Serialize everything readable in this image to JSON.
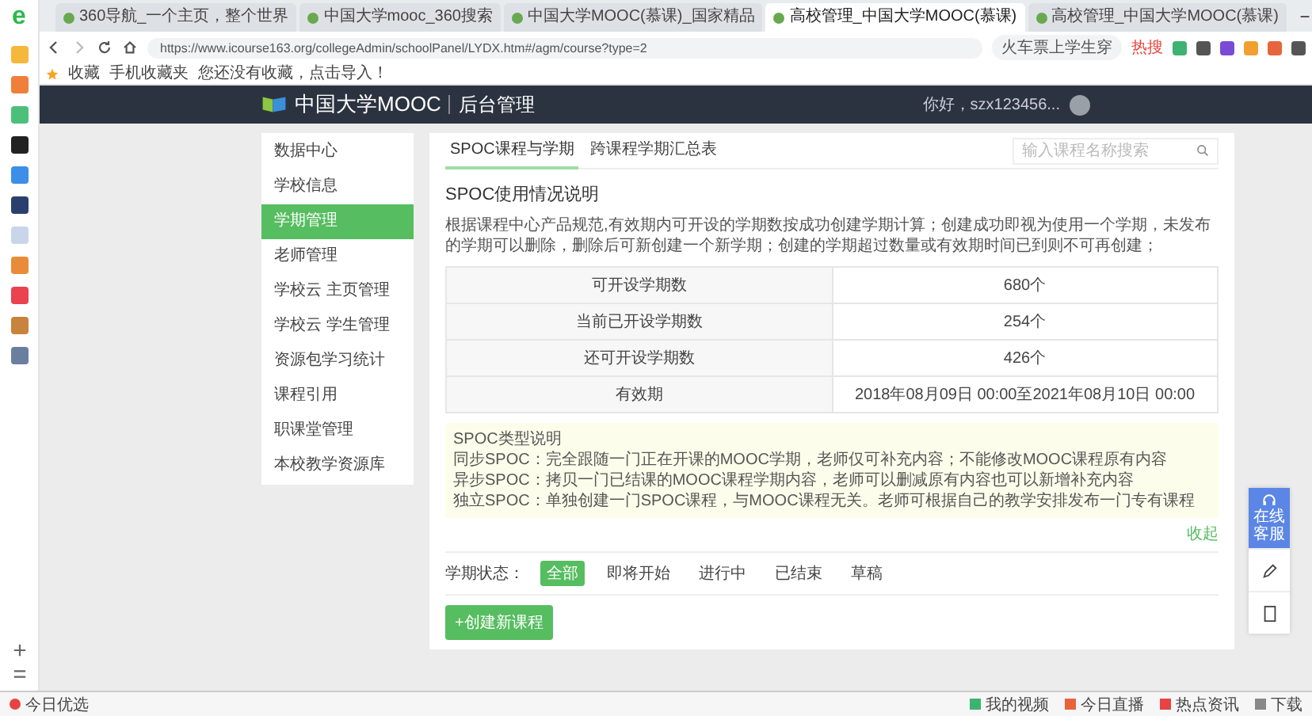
{
  "browser": {
    "logo": "e",
    "tabs": [
      {
        "title": "360导航_一个主页，整个世界",
        "selected": false
      },
      {
        "title": "中国大学mooc_360搜索",
        "selected": false
      },
      {
        "title": "中国大学MOOC(慕课)_国家精品",
        "selected": false
      },
      {
        "title": "高校管理_中国大学MOOC(慕课)",
        "selected": true
      },
      {
        "title": "高校管理_中国大学MOOC(慕课)",
        "selected": false
      }
    ],
    "url": "https://www.icourse163.org/collegeAdmin/schoolPanel/LYDX.htm#/agm/course?type=2",
    "search": {
      "value": "火车票上学生穿",
      "hot": "热搜"
    },
    "bookmarks": {
      "label": "收藏",
      "mobile": "手机收藏夹",
      "hint": "您还没有收藏，点击导入！"
    }
  },
  "header": {
    "logo": "中国大学MOOC",
    "subtitle": "后台管理",
    "greeting": "你好，szx123456..."
  },
  "sidebar": {
    "items": [
      {
        "label": "数据中心",
        "selected": false
      },
      {
        "label": "学校信息",
        "selected": false
      },
      {
        "label": "学期管理",
        "selected": true
      },
      {
        "label": "老师管理",
        "selected": false
      },
      {
        "label": "学校云 主页管理",
        "selected": false
      },
      {
        "label": "学校云 学生管理",
        "selected": false
      },
      {
        "label": "资源包学习统计",
        "selected": false
      },
      {
        "label": "课程引用",
        "selected": false
      },
      {
        "label": "职课堂管理",
        "selected": false
      },
      {
        "label": "本校教学资源库",
        "selected": false
      }
    ]
  },
  "panel": {
    "tabs": [
      {
        "label": "SPOC课程与学期",
        "selected": true
      },
      {
        "label": "跨课程学期汇总表",
        "selected": false
      }
    ],
    "search": {
      "placeholder": "输入课程名称搜索"
    },
    "title": "SPOC使用情况说明",
    "description": "根据课程中心产品规范,有效期内可开设的学期数按成功创建学期计算；创建成功即视为使用一个学期，未发布的学期可以删除，删除后可新创建一个新学期；创建的学期超过数量或有效期时间已到则不可再创建；",
    "table": {
      "rows": [
        {
          "label": "可开设学期数",
          "value": "680个"
        },
        {
          "label": "当前已开设学期数",
          "value": "254个"
        },
        {
          "label": "还可开设学期数",
          "value": "426个"
        },
        {
          "label": "有效期",
          "value": "2018年08月09日 00:00至2021年08月10日 00:00"
        }
      ]
    },
    "notice": {
      "title": "SPOC类型说明",
      "lines": [
        "同步SPOC：完全跟随一门正在开课的MOOC学期，老师仅可补充内容；不能修改MOOC课程原有内容",
        "异步SPOC：拷贝一门已结课的MOOC课程学期内容，老师可以删减原有内容也可以新增补充内容",
        "独立SPOC：单独创建一门SPOC课程，与MOOC课程无关。老师可根据自己的教学安排发布一门专有课程"
      ]
    },
    "collapse": "收起",
    "filter": {
      "label": "学期状态：",
      "options": [
        {
          "label": "全部",
          "selected": true
        },
        {
          "label": "即将开始",
          "selected": false
        },
        {
          "label": "进行中",
          "selected": false
        },
        {
          "label": "已结束",
          "selected": false
        },
        {
          "label": "草稿",
          "selected": false
        }
      ]
    },
    "create_button": "+创建新课程"
  },
  "float_panel": {
    "service": "在线客服"
  },
  "status_bar": {
    "left": "今日优选",
    "items": [
      "我的视频",
      "今日直播",
      "热点资讯",
      "下载"
    ]
  }
}
